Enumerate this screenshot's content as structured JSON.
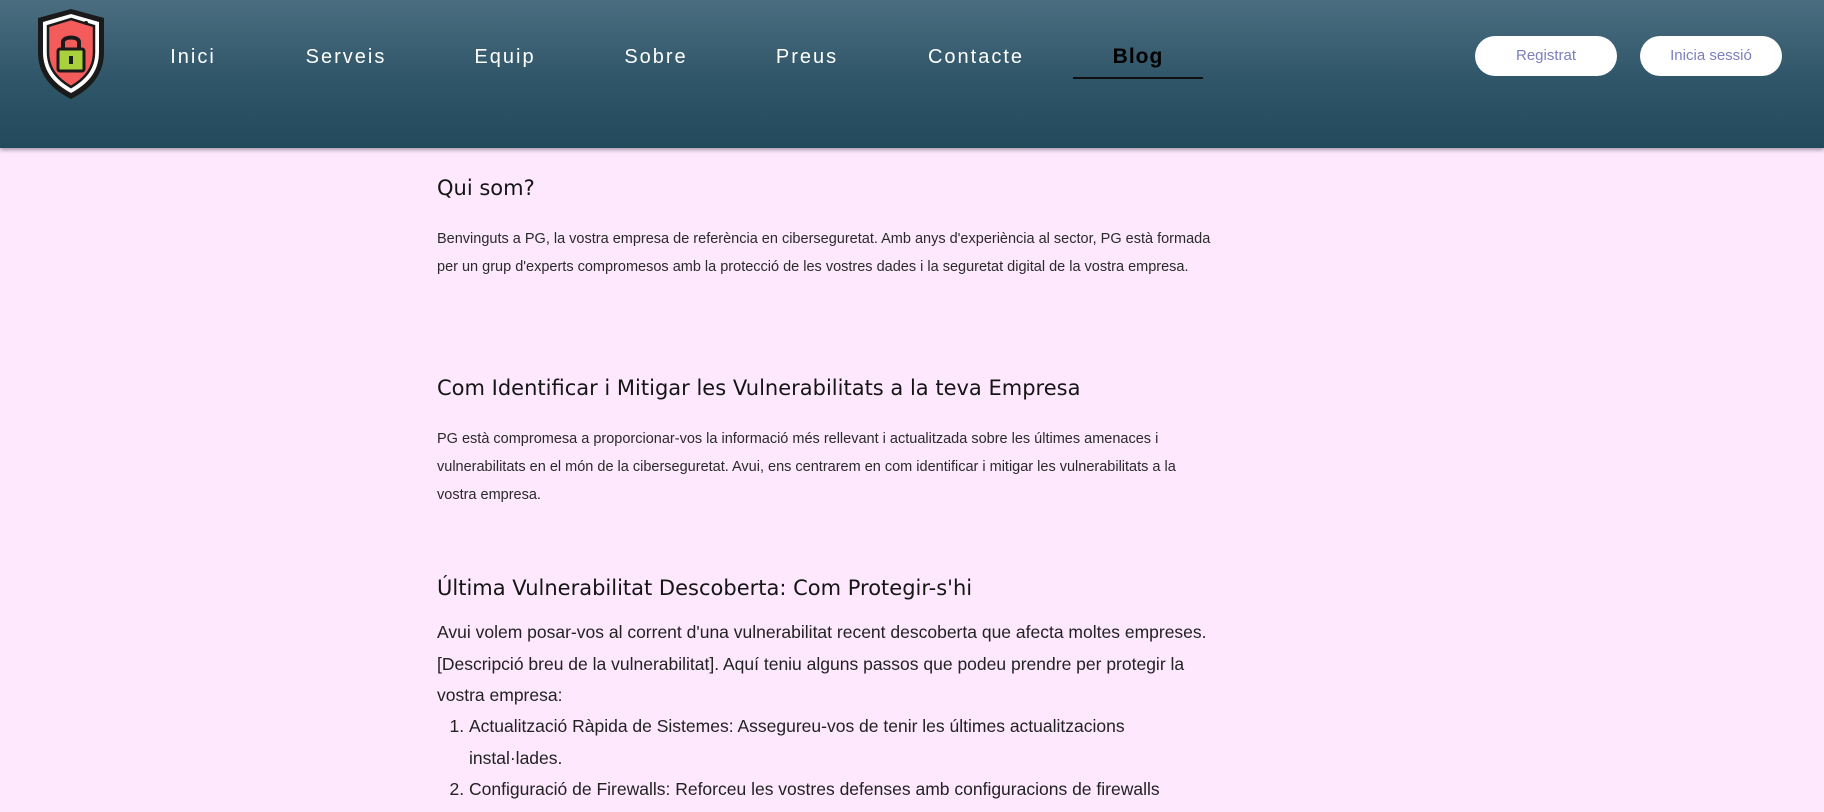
{
  "header": {
    "logo_icon": "shield-lock-icon",
    "nav": [
      {
        "label": "Inici"
      },
      {
        "label": "Serveis"
      },
      {
        "label": "Equip"
      },
      {
        "label": "Sobre"
      },
      {
        "label": "Preus"
      },
      {
        "label": "Contacte"
      },
      {
        "label": "Blog",
        "active": true
      }
    ],
    "register_label": "Registrat",
    "login_label": "Inicia sessió"
  },
  "colors": {
    "header_top": "#4a6e80",
    "header_bottom": "#234a5c",
    "page_background": "#fde8fe",
    "button_text": "#7b7fbf",
    "shield_red": "#f45c5c",
    "lock_green": "#a8d13c"
  },
  "article": {
    "sections": [
      {
        "heading": "Qui som?",
        "body": "Benvinguts a PG, la vostra empresa de referència en ciberseguretat. Amb anys d'experiència al sector, PG està formada per un grup d'experts compromesos amb la protecció de les vostres dades i la seguretat digital de la vostra empresa."
      },
      {
        "heading": "Com Identificar i Mitigar les Vulnerabilitats a la teva Empresa",
        "body": "PG està compromesa a proporcionar-vos la informació més rellevant i actualitzada sobre les últimes amenaces i vulnerabilitats en el món de la ciberseguretat. Avui, ens centrarem en com identificar i mitigar les vulnerabilitats a la vostra empresa."
      },
      {
        "heading": "Última Vulnerabilitat Descoberta: Com Protegir-s'hi",
        "body": "Avui volem posar-vos al corrent d'una vulnerabilitat recent descoberta que afecta moltes empreses. [Descripció breu de la vulnerabilitat]. Aquí teniu alguns passos que podeu prendre per protegir la vostra empresa:",
        "steps": [
          "Actualització Ràpida de Sistemes: Assegureu-vos de tenir les últimes actualitzacions instal·lades.",
          "Configuració de Firewalls: Reforceu les vostres defenses amb configuracions de firewalls"
        ]
      }
    ]
  }
}
